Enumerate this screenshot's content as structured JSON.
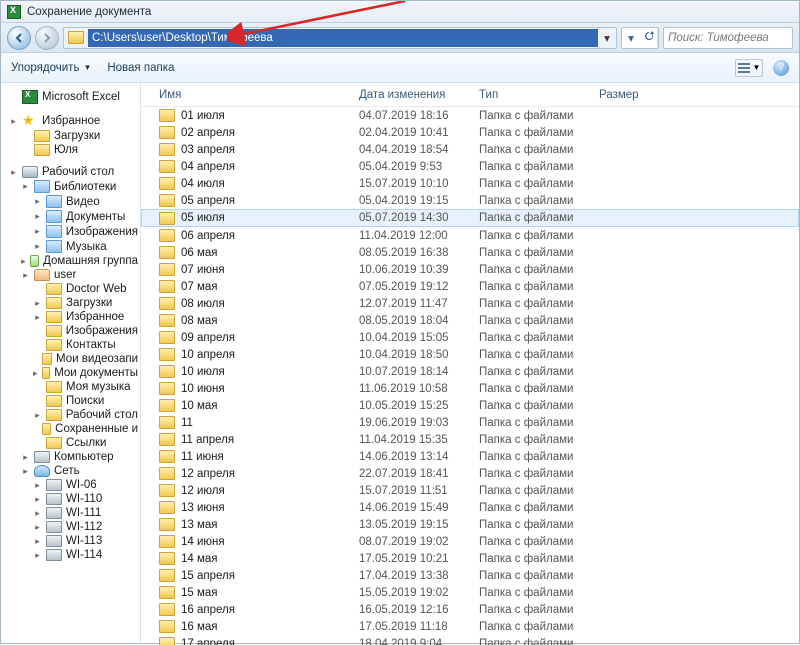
{
  "window": {
    "title": "Сохранение документа"
  },
  "addressbar": {
    "path": "C:\\Users\\user\\Desktop\\Тимофеева"
  },
  "search": {
    "placeholder": "Поиск: Тимофеева"
  },
  "toolbar": {
    "organize": "Упорядочить",
    "newfolder": "Новая папка"
  },
  "columns": {
    "name": "Имя",
    "date": "Дата изменения",
    "type": "Тип",
    "size": "Размер"
  },
  "rowtype": "Папка с файлами",
  "sidebar": [
    {
      "label": "Microsoft Excel",
      "ico": "excel",
      "tri": "",
      "lvl": 0,
      "sep": true
    },
    {
      "label": "Избранное",
      "ico": "star",
      "tri": "▸",
      "lvl": 0
    },
    {
      "label": "Загрузки",
      "ico": "fold",
      "tri": "",
      "lvl": 1
    },
    {
      "label": "Юля",
      "ico": "fold",
      "tri": "",
      "lvl": 1,
      "sep": true
    },
    {
      "label": "Рабочий стол",
      "ico": "disk",
      "tri": "▸",
      "lvl": 0
    },
    {
      "label": "Библиотеки",
      "ico": "lib",
      "tri": "▸",
      "lvl": 1
    },
    {
      "label": "Видео",
      "ico": "lib",
      "tri": "▸",
      "lvl": 2
    },
    {
      "label": "Документы",
      "ico": "lib",
      "tri": "▸",
      "lvl": 2
    },
    {
      "label": "Изображения",
      "ico": "lib",
      "tri": "▸",
      "lvl": 2
    },
    {
      "label": "Музыка",
      "ico": "lib",
      "tri": "▸",
      "lvl": 2
    },
    {
      "label": "Домашняя группа",
      "ico": "group",
      "tri": "▸",
      "lvl": 1
    },
    {
      "label": "user",
      "ico": "user",
      "tri": "▸",
      "lvl": 1
    },
    {
      "label": "Doctor Web",
      "ico": "fold",
      "tri": "",
      "lvl": 2
    },
    {
      "label": "Загрузки",
      "ico": "fold",
      "tri": "▸",
      "lvl": 2
    },
    {
      "label": "Избранное",
      "ico": "fold",
      "tri": "▸",
      "lvl": 2
    },
    {
      "label": "Изображения",
      "ico": "fold",
      "tri": "",
      "lvl": 2
    },
    {
      "label": "Контакты",
      "ico": "fold",
      "tri": "",
      "lvl": 2
    },
    {
      "label": "Мои видеозапи",
      "ico": "fold",
      "tri": "",
      "lvl": 2
    },
    {
      "label": "Мои документы",
      "ico": "fold",
      "tri": "▸",
      "lvl": 2
    },
    {
      "label": "Моя музыка",
      "ico": "fold",
      "tri": "",
      "lvl": 2
    },
    {
      "label": "Поиски",
      "ico": "fold",
      "tri": "",
      "lvl": 2
    },
    {
      "label": "Рабочий стол",
      "ico": "fold",
      "tri": "▸",
      "lvl": 2
    },
    {
      "label": "Сохраненные и",
      "ico": "fold",
      "tri": "",
      "lvl": 2
    },
    {
      "label": "Ссылки",
      "ico": "fold",
      "tri": "",
      "lvl": 2
    },
    {
      "label": "Компьютер",
      "ico": "comp",
      "tri": "▸",
      "lvl": 1
    },
    {
      "label": "Сеть",
      "ico": "net",
      "tri": "▸",
      "lvl": 1
    },
    {
      "label": "WI-06",
      "ico": "comp",
      "tri": "▸",
      "lvl": 2
    },
    {
      "label": "WI-110",
      "ico": "comp",
      "tri": "▸",
      "lvl": 2
    },
    {
      "label": "WI-111",
      "ico": "comp",
      "tri": "▸",
      "lvl": 2
    },
    {
      "label": "WI-112",
      "ico": "comp",
      "tri": "▸",
      "lvl": 2
    },
    {
      "label": "WI-113",
      "ico": "comp",
      "tri": "▸",
      "lvl": 2
    },
    {
      "label": "WI-114",
      "ico": "comp",
      "tri": "▸",
      "lvl": 2
    }
  ],
  "rows": [
    {
      "name": "01 июля",
      "date": "04.07.2019 18:16"
    },
    {
      "name": "02 апреля",
      "date": "02.04.2019 10:41"
    },
    {
      "name": "03 апреля",
      "date": "04.04.2019 18:54"
    },
    {
      "name": "04 апреля",
      "date": "05.04.2019 9:53"
    },
    {
      "name": "04 июля",
      "date": "15.07.2019 10:10"
    },
    {
      "name": "05 апреля",
      "date": "05.04.2019 19:15"
    },
    {
      "name": "05 июля",
      "date": "05.07.2019 14:30",
      "sel": true
    },
    {
      "name": "06 апреля",
      "date": "11.04.2019 12:00"
    },
    {
      "name": "06 мая",
      "date": "08.05.2019 16:38"
    },
    {
      "name": "07 июня",
      "date": "10.06.2019 10:39"
    },
    {
      "name": "07 мая",
      "date": "07.05.2019 19:12"
    },
    {
      "name": "08 июля",
      "date": "12.07.2019 11:47"
    },
    {
      "name": "08 мая",
      "date": "08.05.2019 18:04"
    },
    {
      "name": "09 апреля",
      "date": "10.04.2019 15:05"
    },
    {
      "name": "10 апреля",
      "date": "10.04.2019 18:50"
    },
    {
      "name": "10 июля",
      "date": "10.07.2019 18:14"
    },
    {
      "name": "10 июня",
      "date": "11.06.2019 10:58"
    },
    {
      "name": "10 мая",
      "date": "10.05.2019 15:25"
    },
    {
      "name": "11",
      "date": "19.06.2019 19:03"
    },
    {
      "name": "11 апреля",
      "date": "11.04.2019 15:35"
    },
    {
      "name": "11 июня",
      "date": "14.06.2019 13:14"
    },
    {
      "name": "12 апреля",
      "date": "22.07.2019 18:41"
    },
    {
      "name": "12 июля",
      "date": "15.07.2019 11:51"
    },
    {
      "name": "13 июня",
      "date": "14.06.2019 15:49"
    },
    {
      "name": "13 мая",
      "date": "13.05.2019 19:15"
    },
    {
      "name": "14 июня",
      "date": "08.07.2019 19:02"
    },
    {
      "name": "14 мая",
      "date": "17.05.2019 10:21"
    },
    {
      "name": "15 апреля",
      "date": "17.04.2019 13:38"
    },
    {
      "name": "15 мая",
      "date": "15.05.2019 19:02"
    },
    {
      "name": "16 апреля",
      "date": "16.05.2019 12:16"
    },
    {
      "name": "16 мая",
      "date": "17.05.2019 11:18"
    },
    {
      "name": "17 апреля",
      "date": "18.04.2019 9:04"
    }
  ]
}
